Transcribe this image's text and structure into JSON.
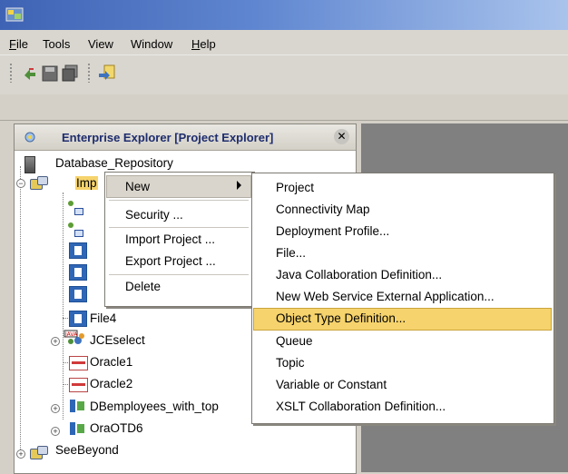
{
  "menubar": {
    "file": "File",
    "tools": "Tools",
    "view": "View",
    "window": "Window",
    "help": "Help"
  },
  "toolbar": {
    "buttons": [
      "refresh-icon",
      "save-icon",
      "save-all-icon",
      "import-icon"
    ]
  },
  "explorer": {
    "title": "Enterprise Explorer [Project Explorer]",
    "close_glyph": "✕"
  },
  "tree": {
    "repository": "Database_Repository",
    "selected_project_partial": "Imp",
    "file4": "File4",
    "jceselect": "JCEselect",
    "oracle1": "Oracle1",
    "oracle2": "Oracle2",
    "dbemployees": "DBemployees_with_top",
    "oraotd6": "OraOTD6",
    "seebeyond": "SeeBeyond"
  },
  "context_menu": {
    "new": "New",
    "security": "Security ...",
    "import_project": "Import Project ...",
    "export_project": "Export Project ...",
    "delete": "Delete"
  },
  "submenu": {
    "items": [
      "Project",
      "Connectivity Map",
      "Deployment Profile...",
      "File...",
      "Java Collaboration Definition...",
      "New Web Service External Application...",
      "Object Type Definition...",
      "Queue",
      "Topic",
      "Variable or Constant",
      "XSLT Collaboration Definition..."
    ],
    "selected": "Object Type Definition..."
  },
  "colors": {
    "titlebar_start": "#3f63b4",
    "highlight": "#f6d36c",
    "explorer_title": "#1f2d6e"
  }
}
